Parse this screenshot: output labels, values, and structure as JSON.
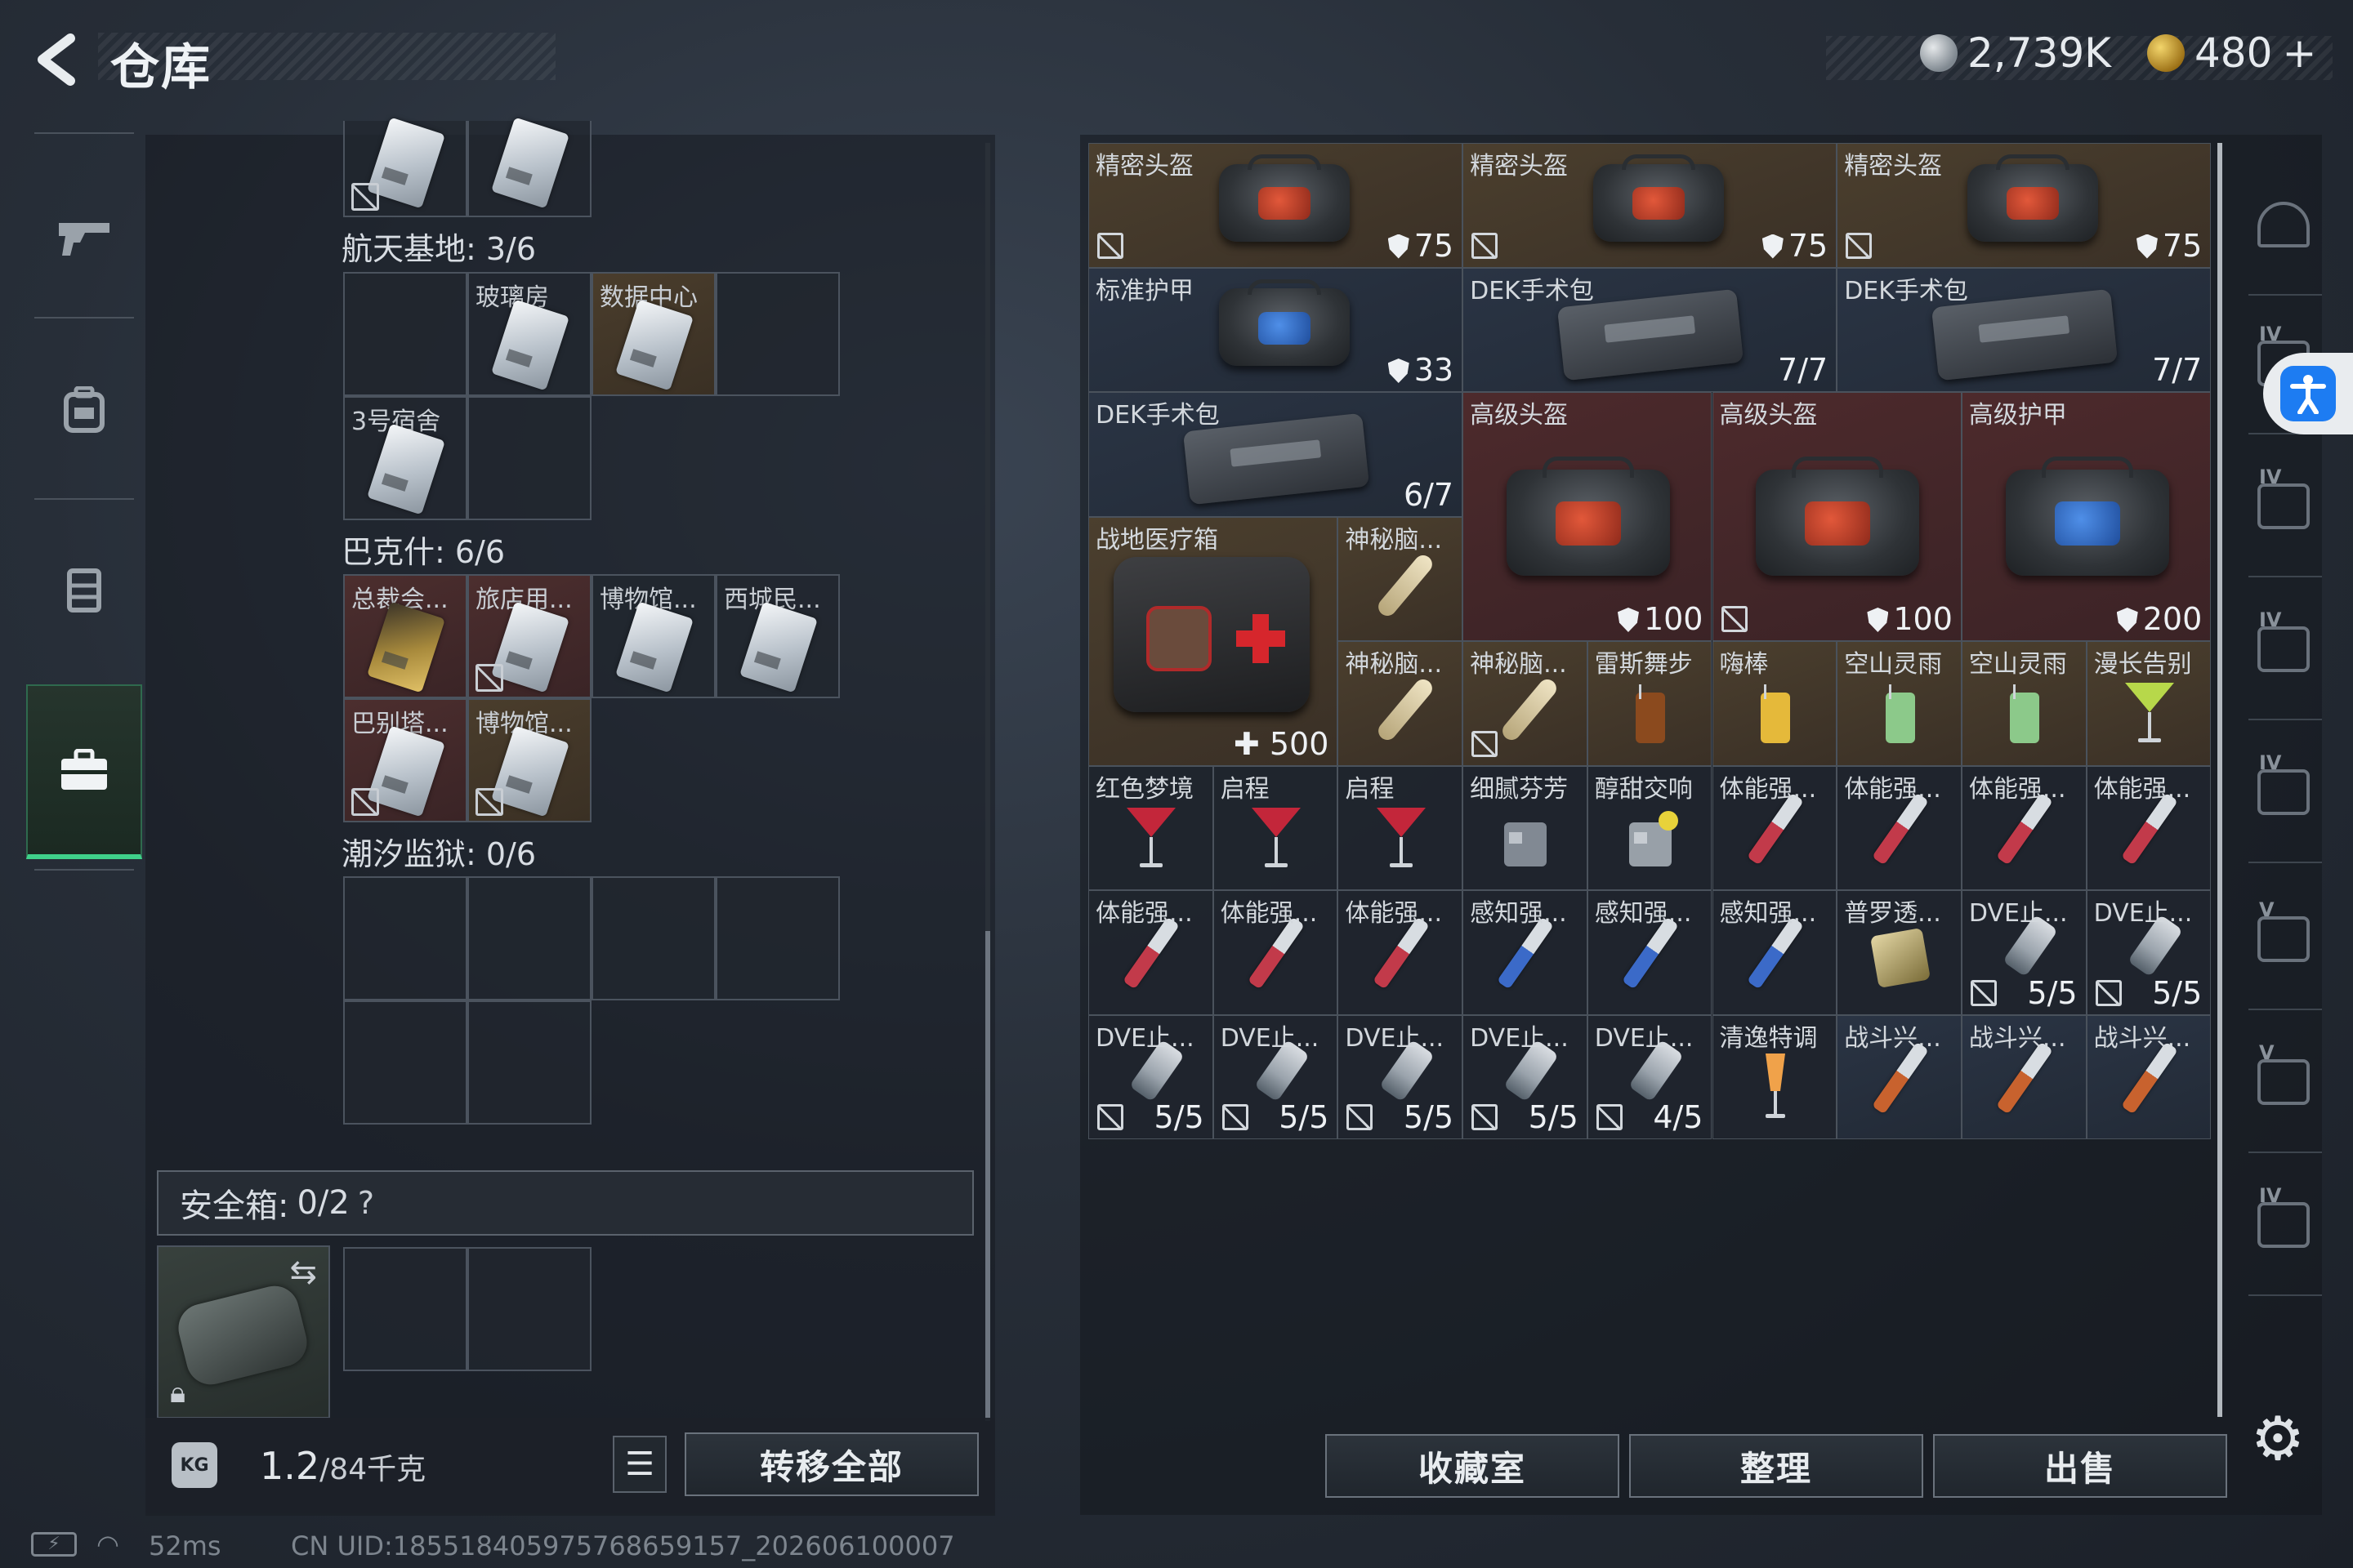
{
  "header": {
    "back_icon": "back-arrow-icon",
    "title": "仓库",
    "currency": [
      {
        "icon": "silver-coin-icon",
        "amount": "2,739K"
      },
      {
        "icon": "gold-coin-icon",
        "amount": "480"
      },
      {
        "icon": "plus-icon",
        "amount": "+"
      }
    ]
  },
  "left_nav": [
    {
      "icon": "gun-icon"
    },
    {
      "icon": "backpack-icon"
    },
    {
      "icon": "vest-icon"
    },
    {
      "icon": "toolbox-icon",
      "active": true
    }
  ],
  "storage": {
    "sections": [
      {
        "title": "航天基地: 3/6",
        "cells": [
          {
            "label": "",
            "tier": "gray",
            "locked": true
          },
          {
            "label": "",
            "tier": "gray",
            "locked": false
          }
        ]
      },
      {
        "title": "巴克什: 6/6",
        "cells": [
          {
            "label": "",
            "tier": "empty"
          },
          {
            "label": "玻璃房",
            "tier": "gray"
          },
          {
            "label": "数据中心",
            "tier": "gold"
          },
          {
            "label": "",
            "tier": "empty"
          },
          {
            "label": "3号宿舍",
            "tier": "gray"
          },
          {
            "label": "",
            "tier": "empty"
          }
        ]
      },
      {
        "title": "潮汐监狱: 0/6",
        "cells": [
          {
            "label": "总裁会...",
            "tier": "red",
            "card": "gold"
          },
          {
            "label": "旅店用...",
            "tier": "red",
            "nosell": true
          },
          {
            "label": "博物馆...",
            "tier": "gray"
          },
          {
            "label": "西城民...",
            "tier": "gray"
          },
          {
            "label": "巴别塔...",
            "tier": "red",
            "nosell": true
          },
          {
            "label": "博物馆...",
            "tier": "gold",
            "nosell": true
          }
        ]
      }
    ],
    "safe_box": {
      "label": "安全箱:",
      "value": "0/2",
      "help": "?"
    },
    "safe_case_icons": {
      "swap": "swap-icon",
      "lock": "lock-icon"
    },
    "weight": {
      "current": "1.2",
      "max": "/84千克",
      "icon_text": "KG"
    },
    "list_icon": "list-icon",
    "transfer_all": "转移全部"
  },
  "inventory": {
    "items": [
      {
        "name": "精密头盔",
        "value": "75",
        "shield": true,
        "nosell": true,
        "tier": "gold",
        "art": "helmet-red"
      },
      {
        "name": "精密头盔",
        "value": "75",
        "shield": true,
        "nosell": true,
        "tier": "gold",
        "art": "helmet-red"
      },
      {
        "name": "精密头盔",
        "value": "75",
        "shield": true,
        "nosell": true,
        "tier": "gold",
        "art": "helmet-red"
      },
      {
        "name": "标准护甲",
        "value": "33",
        "shield": true,
        "tier": "blue",
        "art": "armor-blue"
      },
      {
        "name": "DEK手术包",
        "value": "7/7",
        "tier": "blue",
        "art": "kit"
      },
      {
        "name": "DEK手术包",
        "value": "7/7",
        "tier": "blue",
        "art": "kit"
      },
      {
        "name": "DEK手术包",
        "value": "6/7",
        "tier": "blue",
        "art": "kit"
      },
      {
        "name": "高级头盔",
        "value": "100",
        "shield": true,
        "tier": "red",
        "art": "helmet-red"
      },
      {
        "name": "高级头盔",
        "value": "100",
        "shield": true,
        "nosell": true,
        "tier": "red",
        "art": "helmet-red"
      },
      {
        "name": "高级护甲",
        "value": "200",
        "shield": true,
        "tier": "red",
        "art": "armor-blue"
      },
      {
        "name": "战地医疗箱",
        "value": "500",
        "plus": true,
        "tier": "gold",
        "art": "medbox"
      },
      {
        "name": "神秘脑...",
        "value": "",
        "tier": "gold",
        "art": "bone"
      },
      {
        "name": "神秘脑...",
        "value": "",
        "tier": "gold",
        "art": "bone"
      },
      {
        "name": "神秘脑...",
        "value": "",
        "nosell": true,
        "tier": "gold",
        "art": "bone"
      },
      {
        "name": "雷斯舞步",
        "value": "",
        "tier": "gold",
        "art": "drink-brown"
      },
      {
        "name": "嗨棒",
        "value": "",
        "tier": "gold",
        "art": "drink-yellow"
      },
      {
        "name": "空山灵雨",
        "value": "",
        "tier": "gold",
        "art": "drink-green"
      },
      {
        "name": "空山灵雨",
        "value": "",
        "tier": "gold",
        "art": "drink-green"
      },
      {
        "name": "漫长告别",
        "value": "",
        "tier": "gold",
        "art": "drink-lime"
      },
      {
        "name": "红色梦境",
        "value": "",
        "tier": "gray",
        "art": "cocktail-red"
      },
      {
        "name": "启程",
        "value": "",
        "tier": "gray",
        "art": "cocktail-red"
      },
      {
        "name": "启程",
        "value": "",
        "tier": "gray",
        "art": "cocktail-red"
      },
      {
        "name": "细腻芬芳",
        "value": "",
        "tier": "gray",
        "art": "tumbler"
      },
      {
        "name": "醇甜交响",
        "value": "",
        "tier": "gray",
        "art": "tumbler-lemon"
      },
      {
        "name": "体能强...",
        "value": "",
        "tier": "gray",
        "art": "syringe-red"
      },
      {
        "name": "体能强...",
        "value": "",
        "tier": "gray",
        "art": "syringe-red"
      },
      {
        "name": "体能强...",
        "value": "",
        "tier": "gray",
        "art": "syringe-red"
      },
      {
        "name": "体能强...",
        "value": "",
        "tier": "gray",
        "art": "syringe-red"
      },
      {
        "name": "体能强...",
        "value": "",
        "tier": "gray",
        "art": "syringe-red"
      },
      {
        "name": "体能强...",
        "value": "",
        "tier": "gray",
        "art": "syringe-red"
      },
      {
        "name": "体能强...",
        "value": "",
        "tier": "gray",
        "art": "syringe-red"
      },
      {
        "name": "感知强...",
        "value": "",
        "tier": "gray",
        "art": "syringe-blue"
      },
      {
        "name": "感知强...",
        "value": "",
        "tier": "gray",
        "art": "syringe-blue"
      },
      {
        "name": "感知强...",
        "value": "",
        "tier": "gray",
        "art": "syringe-blue"
      },
      {
        "name": "普罗透...",
        "value": "",
        "tier": "gray",
        "art": "pouch"
      },
      {
        "name": "DVE止...",
        "value": "5/5",
        "nosell": true,
        "tier": "gray",
        "art": "vial"
      },
      {
        "name": "DVE止...",
        "value": "5/5",
        "nosell": true,
        "tier": "gray",
        "art": "vial"
      },
      {
        "name": "DVE止...",
        "value": "5/5",
        "nosell": true,
        "tier": "gray",
        "art": "vial"
      },
      {
        "name": "DVE止...",
        "value": "5/5",
        "nosell": true,
        "tier": "gray",
        "art": "vial"
      },
      {
        "name": "DVE止...",
        "value": "5/5",
        "nosell": true,
        "tier": "gray",
        "art": "vial"
      },
      {
        "name": "DVE止...",
        "value": "5/5",
        "nosell": true,
        "tier": "gray",
        "art": "vial"
      },
      {
        "name": "DVE止...",
        "value": "4/5",
        "nosell": true,
        "tier": "gray",
        "art": "vial"
      },
      {
        "name": "清逸特调",
        "value": "",
        "tier": "gray",
        "art": "flute-orange"
      },
      {
        "name": "战斗兴...",
        "value": "",
        "tier": "blue",
        "art": "syringe-orange"
      },
      {
        "name": "战斗兴...",
        "value": "",
        "tier": "blue",
        "art": "syringe-orange"
      },
      {
        "name": "战斗兴...",
        "value": "",
        "tier": "blue",
        "art": "syringe-orange"
      }
    ],
    "buttons": {
      "collection": "收藏室",
      "organize": "整理",
      "sell": "出售"
    }
  },
  "right_rail": [
    {
      "icon": "helmet-slot-icon",
      "tag": ""
    },
    {
      "icon": "case-slot-icon",
      "tag": "IV"
    },
    {
      "icon": "vest-slot-icon",
      "tag": "IV"
    },
    {
      "icon": "folder-slot-icon",
      "tag": "IV"
    },
    {
      "icon": "medkit-slot-icon",
      "tag": "IV"
    },
    {
      "icon": "money-slot-icon",
      "tag": "V"
    },
    {
      "icon": "money-slot-icon",
      "tag": "V"
    },
    {
      "icon": "map-slot-icon",
      "tag": "IV"
    }
  ],
  "accessibility_icon": "accessibility-icon",
  "settings_icon": "gear-icon",
  "status_bar": {
    "battery_icon": "battery-charging-icon",
    "wifi_icon": "wifi-icon",
    "ping": "52ms",
    "uid": "CN UID:185518405975768659157_202606100007"
  },
  "colors": {
    "accent_green": "#3fd18a",
    "tier_gold": "#4b3f2e",
    "tier_red": "#4d2a2c",
    "tier_blue": "#2a3444"
  }
}
